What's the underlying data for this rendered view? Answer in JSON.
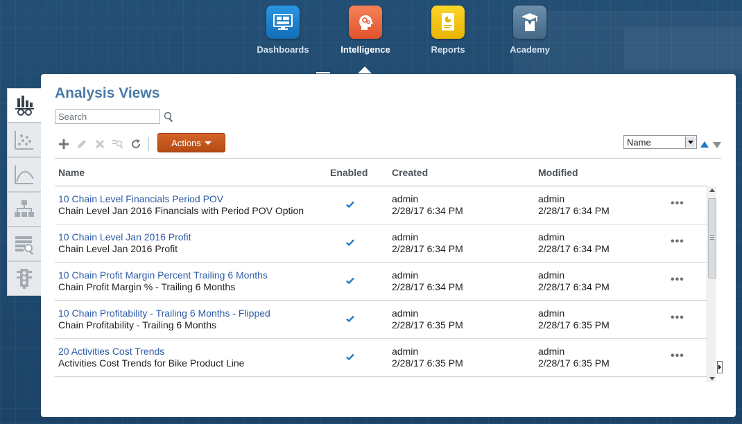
{
  "nav": {
    "items": [
      {
        "label": "Dashboards",
        "icon": "dashboards-icon",
        "color": "#1a7fcf"
      },
      {
        "label": "Intelligence",
        "icon": "intelligence-icon",
        "color": "#ef6b42",
        "active": true
      },
      {
        "label": "Reports",
        "icon": "reports-icon",
        "color": "#f2c20d"
      },
      {
        "label": "Academy",
        "icon": "academy-icon",
        "color": "#4f7394"
      }
    ]
  },
  "sidebar": {
    "tabs": [
      {
        "icon": "analysis-views-icon",
        "active": true
      },
      {
        "icon": "scatter-plot-icon"
      },
      {
        "icon": "trend-curve-icon"
      },
      {
        "icon": "hierarchy-icon"
      },
      {
        "icon": "table-search-icon"
      },
      {
        "icon": "traffic-light-icon"
      }
    ]
  },
  "page": {
    "title": "Analysis Views"
  },
  "search": {
    "placeholder": "Search",
    "value": ""
  },
  "toolbar": {
    "actions_label": "Actions",
    "sort_value": "Name"
  },
  "table": {
    "headers": {
      "name": "Name",
      "enabled": "Enabled",
      "created": "Created",
      "modified": "Modified"
    },
    "rows": [
      {
        "name": "10 Chain Level Financials Period POV",
        "description": "Chain Level Jan 2016 Financials with Period POV Option",
        "enabled": true,
        "created_by": "admin",
        "created_at": "2/28/17 6:34 PM",
        "modified_by": "admin",
        "modified_at": "2/28/17 6:34 PM",
        "more": "•••"
      },
      {
        "name": "10 Chain Level Jan 2016 Profit",
        "description": "Chain Level Jan 2016 Profit",
        "enabled": true,
        "created_by": "admin",
        "created_at": "2/28/17 6:34 PM",
        "modified_by": "admin",
        "modified_at": "2/28/17 6:34 PM",
        "more": "•••"
      },
      {
        "name": "10 Chain Profit Margin Percent Trailing 6 Months",
        "description": "Chain Profit Margin % - Trailing 6 Months",
        "enabled": true,
        "created_by": "admin",
        "created_at": "2/28/17 6:34 PM",
        "modified_by": "admin",
        "modified_at": "2/28/17 6:34 PM",
        "more": "•••"
      },
      {
        "name": "10 Chain Profitability - Trailing 6 Months - Flipped",
        "description": "Chain Profitability - Trailing 6 Months",
        "enabled": true,
        "created_by": "admin",
        "created_at": "2/28/17 6:35 PM",
        "modified_by": "admin",
        "modified_at": "2/28/17 6:35 PM",
        "more": "•••"
      },
      {
        "name": "20 Activities Cost Trends",
        "description": "Activities Cost Trends for Bike Product Line",
        "enabled": true,
        "created_by": "admin",
        "created_at": "2/28/17 6:35 PM",
        "modified_by": "admin",
        "modified_at": "2/28/17 6:35 PM",
        "more": "•••"
      }
    ]
  },
  "colors": {
    "background": "#1f4a6e",
    "title": "#4a7aa8",
    "link": "#2d5ba6",
    "actions_button": "#c4571f",
    "check": "#1c78c8"
  }
}
